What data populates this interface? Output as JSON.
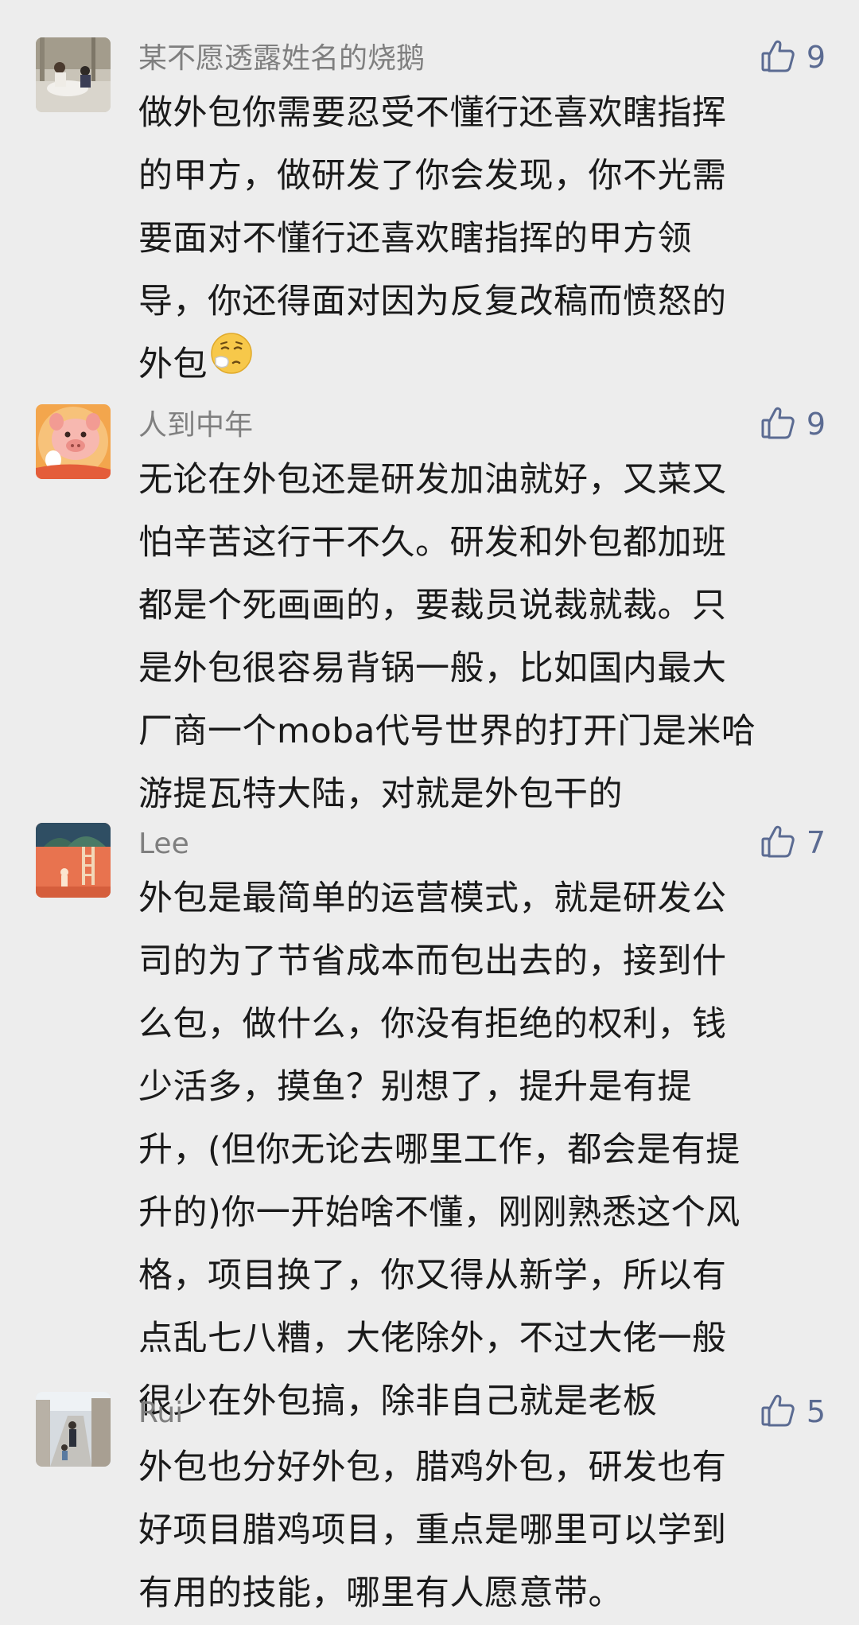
{
  "comments": [
    {
      "username": "某不愿透露姓名的烧鹅",
      "likes": "9",
      "avatar": "photo-couple-outdoor",
      "lines": [
        "做外包你需要忍受不懂行还喜欢瞎指挥",
        "的甲方，做研发了你会发现，你不光需",
        "要面对不懂行还喜欢瞎指挥的甲方领",
        "导，你还得面对因为反复改稿而愤怒的",
        "外包"
      ],
      "emoji": "sneezing-face-emoji"
    },
    {
      "username": "人到中年",
      "likes": "9",
      "avatar": "cartoon-pig-avatar",
      "lines": [
        "无论在外包还是研发加油就好，又菜又",
        "怕辛苦这行干不久。研发和外包都加班",
        "都是个死画画的，要裁员说裁就裁。只",
        "是外包很容易背锅一般，比如国内最大",
        "厂商一个moba代号世界的打开门是米哈",
        "游提瓦特大陆，对就是外包干的"
      ]
    },
    {
      "username": "Lee",
      "likes": "7",
      "avatar": "illustration-orange-avatar",
      "lines": [
        "外包是最简单的运营模式，就是研发公",
        "司的为了节省成本而包出去的，接到什",
        "么包，做什么，你没有拒绝的权利，钱",
        "少活多，摸鱼？别想了，提升是有提",
        "升，(但你无论去哪里工作，都会是有提",
        "升的)你一开始啥不懂，刚刚熟悉这个风",
        "格，项目换了，你又得从新学，所以有",
        "点乱七八糟，大佬除外，不过大佬一般",
        "很少在外包搞，除非自己就是老板"
      ]
    },
    {
      "username": "Rui",
      "likes": "5",
      "avatar": "photo-street-avatar",
      "lines": [
        "外包也分好外包，腊鸡外包，研发也有",
        "好项目腊鸡项目，重点是哪里可以学到",
        "有用的技能，哪里有人愿意带。"
      ]
    }
  ],
  "colors": {
    "background": "#ededed",
    "username": "#7f7f7f",
    "like": "#5b6b92",
    "text": "#1a1a1a"
  }
}
